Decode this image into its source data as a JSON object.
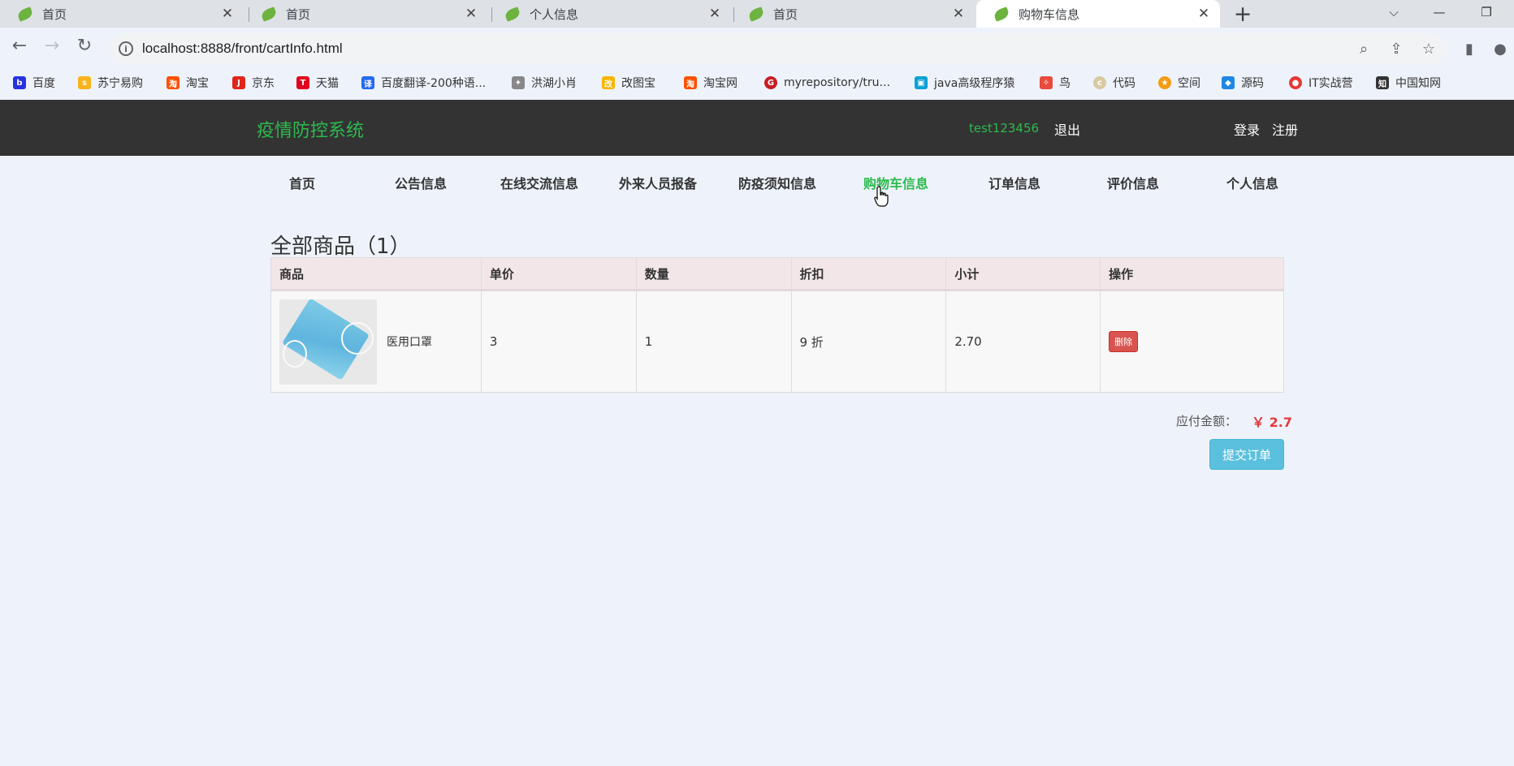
{
  "browser": {
    "tabs": [
      {
        "label": "首页",
        "active": false
      },
      {
        "label": "首页",
        "active": false
      },
      {
        "label": "个人信息",
        "active": false
      },
      {
        "label": "首页",
        "active": false
      },
      {
        "label": "购物车信息",
        "active": true
      }
    ],
    "new_tab_symbol": "+",
    "url": "localhost:8888/front/cartInfo.html",
    "bookmarks": [
      {
        "label": "百度",
        "icon": "baidu-icon",
        "color": "#2932e1"
      },
      {
        "label": "苏宁易购",
        "icon": "suning-icon",
        "color": "#f9b31d"
      },
      {
        "label": "淘宝",
        "icon": "taobao-icon",
        "color": "#ff5000"
      },
      {
        "label": "京东",
        "icon": "jd-icon",
        "color": "#e1251b"
      },
      {
        "label": "天猫",
        "icon": "tmall-icon",
        "color": "#e1001e"
      },
      {
        "label": "百度翻译-200种语...",
        "icon": "translate-icon",
        "color": "#2468f2"
      },
      {
        "label": "洪湖小肖",
        "icon": "bird-icon",
        "color": "#888888"
      },
      {
        "label": "改图宝",
        "icon": "gaitubao-icon",
        "color": "#f7b500"
      },
      {
        "label": "淘宝网",
        "icon": "taobao-icon",
        "color": "#ff5000"
      },
      {
        "label": "myrepository/tru...",
        "icon": "gitee-icon",
        "color": "#c71d23"
      },
      {
        "label": "java高级程序猿",
        "icon": "bilibili-icon",
        "color": "#00a1d6"
      },
      {
        "label": "鸟",
        "icon": "bird-icon",
        "color": "#e94b3c"
      },
      {
        "label": "代码",
        "icon": "code-icon",
        "color": "#d8c9a0"
      },
      {
        "label": "空间",
        "icon": "qzone-icon",
        "color": "#f39c12"
      },
      {
        "label": "源码",
        "icon": "source-icon",
        "color": "#1e88e5"
      },
      {
        "label": "IT实战营",
        "icon": "chrome-icon",
        "color": "#e53935"
      },
      {
        "label": "中国知网",
        "icon": "cnki-icon",
        "color": "#333333"
      }
    ]
  },
  "site": {
    "brand": "疫情防控系统",
    "username": "test123456",
    "logout": "退出",
    "login": "登录",
    "register": "注册",
    "nav": [
      "首页",
      "公告信息",
      "在线交流信息",
      "外来人员报备",
      "防疫须知信息",
      "购物车信息",
      "订单信息",
      "评价信息",
      "个人信息"
    ],
    "active_nav": "购物车信息"
  },
  "cart": {
    "title": "全部商品（1）",
    "headers": [
      "商品",
      "单价",
      "数量",
      "折扣",
      "小计",
      "操作"
    ],
    "rows": [
      {
        "name": "医用口罩",
        "price": "3",
        "qty": "1",
        "discount": "9 折",
        "subtotal": "2.70",
        "action": "删除"
      }
    ],
    "total_label": "应付金额：",
    "total_value": "￥ 2.7",
    "submit_label": "提交订单"
  },
  "colors": {
    "brand_green": "#2dba4e",
    "header_bg": "#333333",
    "delete_red": "#d9534f",
    "submit_blue": "#5bc0de",
    "price_red": "#e4393c"
  }
}
